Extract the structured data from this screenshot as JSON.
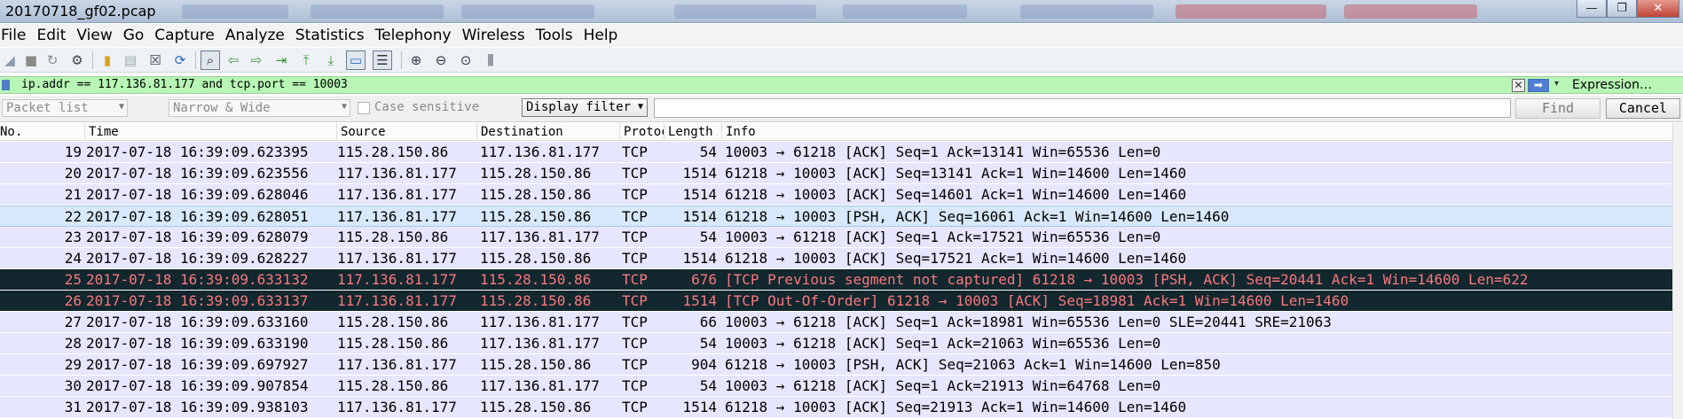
{
  "window": {
    "title": "20170718_gf02.pcap",
    "minimize": "—",
    "maximize": "❐",
    "close": "✕"
  },
  "menu": [
    "File",
    "Edit",
    "View",
    "Go",
    "Capture",
    "Analyze",
    "Statistics",
    "Telephony",
    "Wireless",
    "Tools",
    "Help"
  ],
  "filter": {
    "text": "ip.addr == 117.136.81.177 and tcp.port == 10003",
    "clear_icon": "✕",
    "apply_icon": "➡",
    "dropdown_icon": "▾",
    "expression_label": "Expression…"
  },
  "findbar": {
    "search_in": "Packet list",
    "char_width": "Narrow & Wide",
    "case_sensitive_label": "Case sensitive",
    "search_type": "Display filter",
    "find_label": "Find",
    "cancel_label": "Cancel"
  },
  "packet_list": {
    "columns": [
      "No.",
      "Time",
      "Source",
      "Destination",
      "Protocol",
      "Length",
      "Info"
    ],
    "rows": [
      {
        "no": "19",
        "time": "2017-07-18 16:39:09.623395",
        "src": "115.28.150.86",
        "dst": "117.136.81.177",
        "proto": "TCP",
        "len": "54",
        "info": "10003 → 61218 [ACK] Seq=1 Ack=13141 Win=65536 Len=0"
      },
      {
        "no": "20",
        "time": "2017-07-18 16:39:09.623556",
        "src": "117.136.81.177",
        "dst": "115.28.150.86",
        "proto": "TCP",
        "len": "1514",
        "info": "61218 → 10003 [ACK] Seq=13141 Ack=1 Win=14600 Len=1460"
      },
      {
        "no": "21",
        "time": "2017-07-18 16:39:09.628046",
        "src": "117.136.81.177",
        "dst": "115.28.150.86",
        "proto": "TCP",
        "len": "1514",
        "info": "61218 → 10003 [ACK] Seq=14601 Ack=1 Win=14600 Len=1460"
      },
      {
        "no": "22",
        "time": "2017-07-18 16:39:09.628051",
        "src": "117.136.81.177",
        "dst": "115.28.150.86",
        "proto": "TCP",
        "len": "1514",
        "info": "61218 → 10003 [PSH, ACK] Seq=16061 Ack=1 Win=14600 Len=1460"
      },
      {
        "no": "23",
        "time": "2017-07-18 16:39:09.628079",
        "src": "115.28.150.86",
        "dst": "117.136.81.177",
        "proto": "TCP",
        "len": "54",
        "info": "10003 → 61218 [ACK] Seq=1 Ack=17521 Win=65536 Len=0"
      },
      {
        "no": "24",
        "time": "2017-07-18 16:39:09.628227",
        "src": "117.136.81.177",
        "dst": "115.28.150.86",
        "proto": "TCP",
        "len": "1514",
        "info": "61218 → 10003 [ACK] Seq=17521 Ack=1 Win=14600 Len=1460"
      },
      {
        "no": "25",
        "time": "2017-07-18 16:39:09.633132",
        "src": "117.136.81.177",
        "dst": "115.28.150.86",
        "proto": "TCP",
        "len": "676",
        "info": "[TCP Previous segment not captured] 61218 → 10003 [PSH, ACK] Seq=20441 Ack=1 Win=14600 Len=622"
      },
      {
        "no": "26",
        "time": "2017-07-18 16:39:09.633137",
        "src": "117.136.81.177",
        "dst": "115.28.150.86",
        "proto": "TCP",
        "len": "1514",
        "info": "[TCP Out-Of-Order] 61218 → 10003 [ACK] Seq=18981 Ack=1 Win=14600 Len=1460"
      },
      {
        "no": "27",
        "time": "2017-07-18 16:39:09.633160",
        "src": "115.28.150.86",
        "dst": "117.136.81.177",
        "proto": "TCP",
        "len": "66",
        "info": "10003 → 61218 [ACK] Seq=1 Ack=18981 Win=65536 Len=0 SLE=20441 SRE=21063"
      },
      {
        "no": "28",
        "time": "2017-07-18 16:39:09.633190",
        "src": "115.28.150.86",
        "dst": "117.136.81.177",
        "proto": "TCP",
        "len": "54",
        "info": "10003 → 61218 [ACK] Seq=1 Ack=21063 Win=65536 Len=0"
      },
      {
        "no": "29",
        "time": "2017-07-18 16:39:09.697927",
        "src": "117.136.81.177",
        "dst": "115.28.150.86",
        "proto": "TCP",
        "len": "904",
        "info": "61218 → 10003 [PSH, ACK] Seq=21063 Ack=1 Win=14600 Len=850"
      },
      {
        "no": "30",
        "time": "2017-07-18 16:39:09.907854",
        "src": "115.28.150.86",
        "dst": "117.136.81.177",
        "proto": "TCP",
        "len": "54",
        "info": "10003 → 61218 [ACK] Seq=1 Ack=21913 Win=64768 Len=0"
      },
      {
        "no": "31",
        "time": "2017-07-18 16:39:09.938103",
        "src": "117.136.81.177",
        "dst": "115.28.150.86",
        "proto": "TCP",
        "len": "1514",
        "info": "61218 → 10003 [ACK] Seq=21913 Ack=1 Win=14600 Len=1460"
      }
    ],
    "row_style": [
      "normal",
      "normal",
      "normal",
      "selected",
      "normal",
      "normal",
      "error",
      "error",
      "normal",
      "normal",
      "normal",
      "normal",
      "normal"
    ]
  },
  "colors": {
    "tcp_row": "#e7e6ff",
    "selected_row": "#d7e9fa",
    "error_row_bg": "#12272e",
    "error_row_fg": "#f7787e",
    "filter_valid": "#b7f6b4"
  },
  "toolbar_icons": [
    "shark-fin-icon",
    "stop-capture-icon",
    "restart-capture-icon",
    "capture-options-icon",
    "open-file-icon",
    "file-set-icon",
    "close-file-icon",
    "reload-icon",
    "find-packet-icon",
    "go-back-icon",
    "go-forward-icon",
    "go-to-packet-icon",
    "go-first-icon",
    "go-last-icon",
    "autoscroll-icon",
    "colorize-icon",
    "zoom-in-icon",
    "zoom-out-icon",
    "zoom-normal-icon",
    "resize-columns-icon"
  ]
}
